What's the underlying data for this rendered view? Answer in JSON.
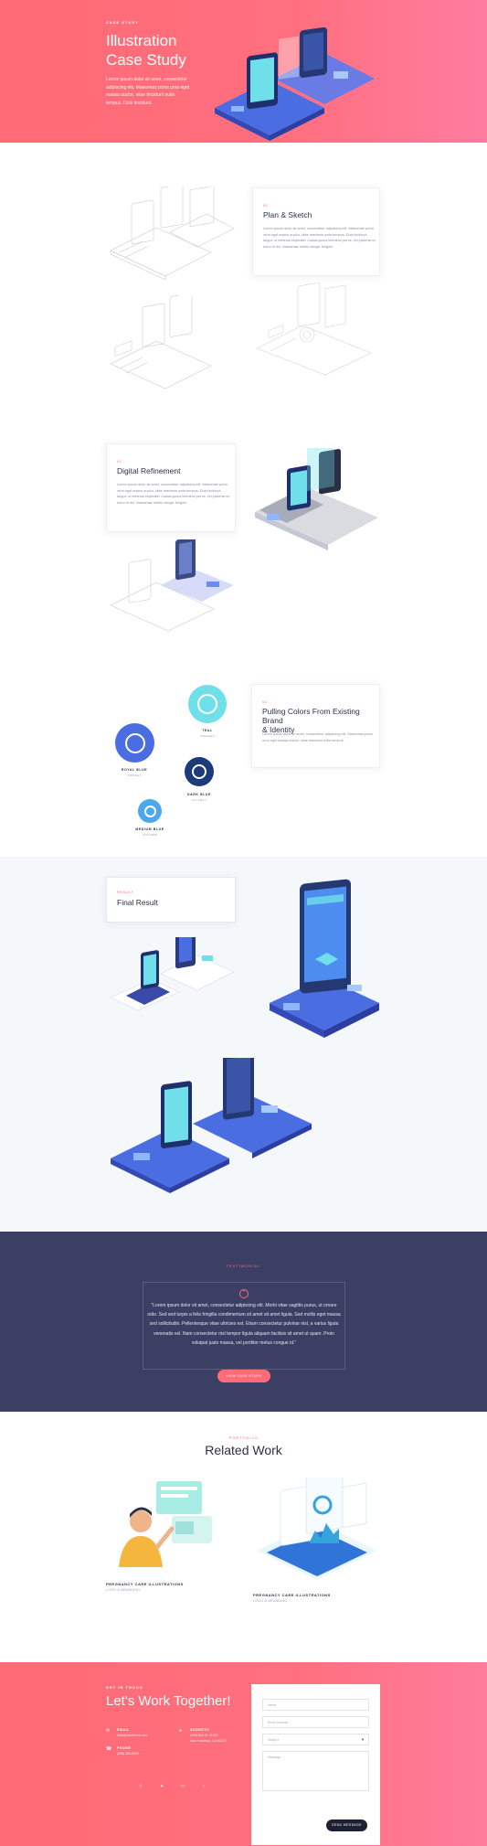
{
  "hero": {
    "eyebrow": "CASE STUDY",
    "title_line1": "Illustration",
    "title_line2": "Case Study",
    "description": "Lorem ipsum dolor sit amet, consectetur adipiscing elit. Maecenas porta urna eget massa auctor, vitae tincidunt nulla tempus. Duis tincidunt."
  },
  "sections": {
    "plan": {
      "number": "01",
      "title": "Plan & Sketch",
      "body": "Lorem ipsum dolor sit amet, consectetur adipiscing elit. Maecenas porta urna eget massa auctor, vitae maximus nulla tempus. Duis tincidunt, augue ut vehicula imperdiet, massa purus interdum purus, vel placerat ex tortor et dui. Maecenas mattis integer fringilla."
    },
    "digital": {
      "number": "02",
      "title": "Digital Refinement",
      "body": "Lorem ipsum dolor sit amet, consectetur adipiscing elit. Maecenas porta urna eget massa auctor, vitae maximus nulla tempus. Duis tincidunt, augue ut vehicula imperdiet, massa purus interdum purus, vel placerat ex tortor et dui. Maecenas mattis integer fringilla."
    },
    "colors": {
      "number": "03",
      "title_line1": "Pulling Colors From Existing Brand",
      "title_line2": "& Identity",
      "body": "Lorem ipsum dolor sit amet, consectetur adipiscing elit. Maecenas porta urna eget massa auctor, vitae maximus nulla tempus."
    },
    "final": {
      "number": "RESULT",
      "title": "Final Result"
    }
  },
  "swatches": [
    {
      "name": "TEAL",
      "hex_label": "#6EE0EA",
      "color": "#6fdfe9"
    },
    {
      "name": "ROYAL BLUE",
      "hex_label": "#4B6FE0",
      "color": "#4b6de2"
    },
    {
      "name": "DARK BLUE",
      "hex_label": "#1C3B7C",
      "color": "#1c3b7c"
    },
    {
      "name": "MEDIUM BLUE",
      "hex_label": "#4DA8EB",
      "color": "#4da8eb"
    }
  ],
  "testimonial": {
    "eyebrow": "TESTIMONIAL",
    "quote": "\"Lorem ipsum dolor sit amet, consectetur adipiscing elit. Morbi vitae sagittis purus, ut ornare odio. Sed sed turpis a felis fringilla condimentum sit amet sit amet ligula. Sed mollis eget massa sed sollicitudin. Pellentesque vitae ultricies est. Etiam consectetur pulvinar nisl, a varius ligula venenatis vel. Nam consectetur nisl tempor ligula aliquam facilisis sit amet ut quam. Proin volutpat justo massa, vel porttitor metus congue id.\"",
    "button": "VIEW CASE STUDY"
  },
  "related": {
    "eyebrow": "PORTFOLIO",
    "title": "Related Work",
    "items": [
      {
        "title": "PREGNANCY CARE ILLUSTRATIONS",
        "subtitle": "LOGO & BRANDING"
      },
      {
        "title": "PREGNANCY CARE ILLUSTRATIONS",
        "subtitle": "LOGO & BRANDING"
      }
    ]
  },
  "contact": {
    "eyebrow": "GET IN TOUCH",
    "title": "Let's Work Together!",
    "email_label": "EMAIL",
    "email_value": "hello@divitheme.com",
    "address_label": "ADDRESS",
    "address_line1": "1234 Divi St. #1000",
    "address_line2": "San Francisco, CA 94220",
    "phone_label": "PHONE",
    "phone_value": "(255) 352-6258",
    "form": {
      "name_placeholder": "Name",
      "email_placeholder": "Email Address",
      "subject_placeholder": "Subject",
      "message_placeholder": "Message",
      "submit": "SEND MESSAGE"
    }
  },
  "colors": {
    "accent": "#ff6b76",
    "navy": "#3b3f63",
    "royal_blue": "#4b6de2"
  }
}
